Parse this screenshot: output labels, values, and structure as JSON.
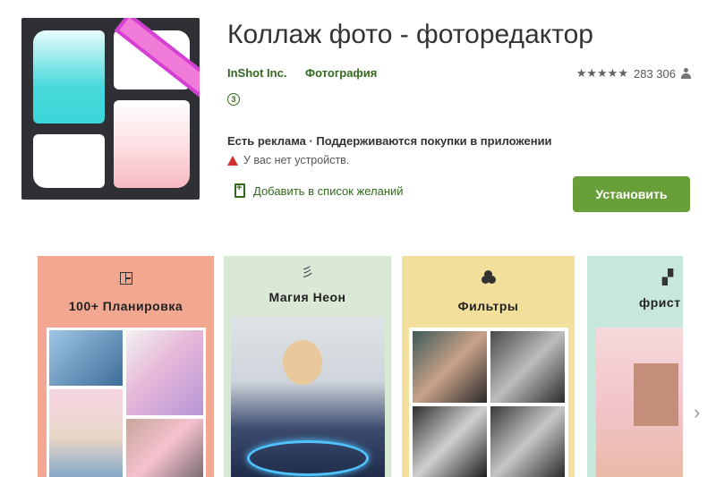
{
  "app": {
    "title": "Коллаж фото - фоторедактор",
    "developer": "InShot Inc.",
    "category": "Фотография",
    "rating_stars": "★★★★★",
    "rating_count": "283 306",
    "age_rating": "3",
    "ads_info": "Есть реклама · Поддерживаются покупки в приложении",
    "warning": "У вас нет устройств.",
    "wishlist_label": "Добавить в список желаний",
    "install_label": "Установить"
  },
  "screenshots": [
    {
      "label": "100+ Планировка",
      "icon": "layout-icon"
    },
    {
      "label": "Магия Неон",
      "icon": "neon-icon",
      "icon_glyph": "彡"
    },
    {
      "label": "Фильтры",
      "icon": "filter-icon"
    },
    {
      "label": "фрист",
      "icon": "frame-icon",
      "icon_glyph": "▞"
    }
  ],
  "nav": {
    "next_glyph": "›"
  },
  "colors": {
    "accent": "#689f38",
    "link": "#33691e"
  }
}
